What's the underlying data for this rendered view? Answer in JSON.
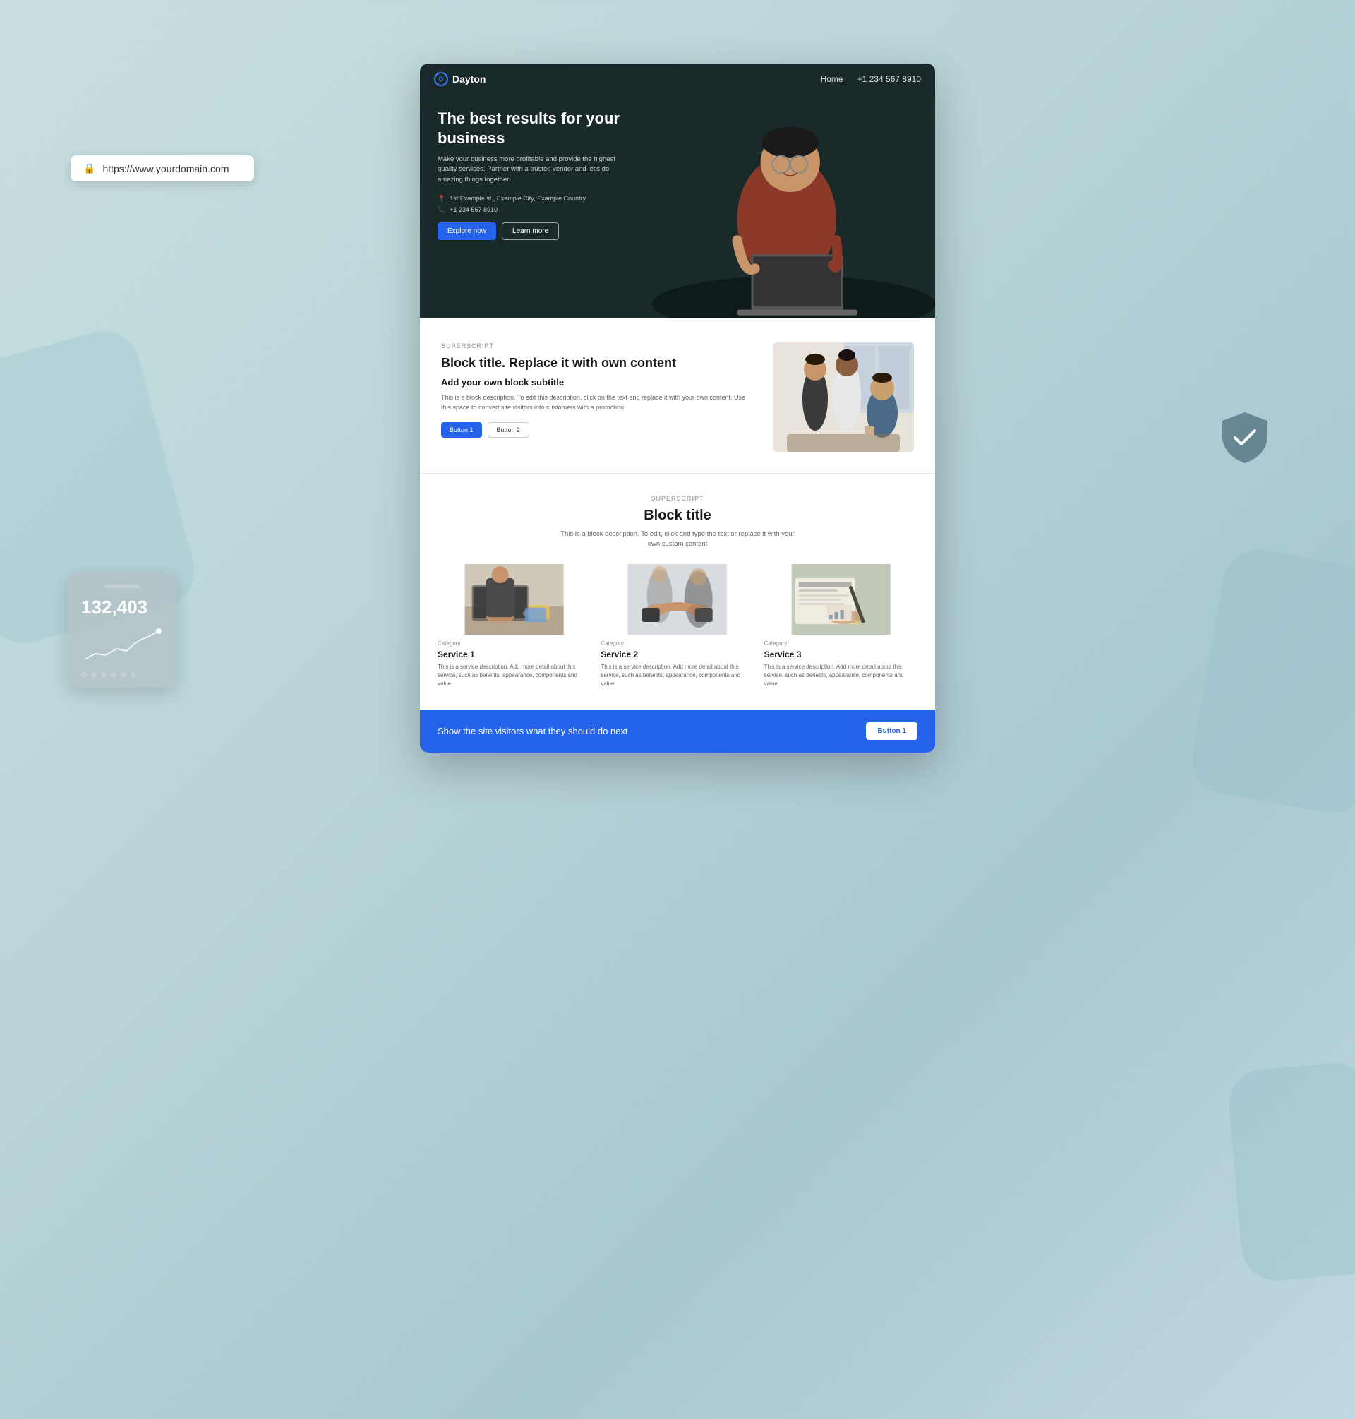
{
  "page": {
    "url": "https://www.yourdomain.com",
    "background": "#c8dfe0"
  },
  "browser": {
    "url_label": "https://www.yourdomain.com"
  },
  "stats_card": {
    "number": "132,403",
    "aria": "Statistics card"
  },
  "website": {
    "nav": {
      "brand": "Dayton",
      "links": [
        "Home"
      ],
      "phone": "+1 234 567 8910"
    },
    "hero": {
      "title": "The best results for your business",
      "description": "Make your business more profitable and provide the highest quality services. Partner with a trusted vendor and let's do amazing things together!",
      "address": "1st Example st., Example City, Example Country",
      "phone": "+1 234 567 8910",
      "btn_primary": "Explore now",
      "btn_secondary": "Learn more"
    },
    "block_section": {
      "superscript": "SUPERSCRIPT",
      "title": "Block title. Replace it with own content",
      "subtitle": "Add your own block subtitle",
      "description": "This is a block description. To edit this description, click on the text and replace it with your own content. Use this space to convert site visitors into customers with a promotion",
      "btn1": "Button 1",
      "btn2": "Button 2"
    },
    "services_section": {
      "superscript": "SUPERSCRIPT",
      "title": "Block title",
      "description": "This is a block description. To edit, click and type the text or replace it with your own custom content",
      "services": [
        {
          "category": "Category",
          "title": "Service 1",
          "description": "This is a service description. Add more detail about this service, such as benefits, appearance, components and value"
        },
        {
          "category": "Category",
          "title": "Service 2",
          "description": "This is a service description. Add more detail about this service, such as benefits, appearance, components and value"
        },
        {
          "category": "Category",
          "title": "Service 3",
          "description": "This is a service description. Add more detail about this service, such as benefits, appearance, components and value"
        }
      ]
    },
    "cta_banner": {
      "text": "Show the site visitors what they should do next",
      "button": "Button 1"
    }
  }
}
